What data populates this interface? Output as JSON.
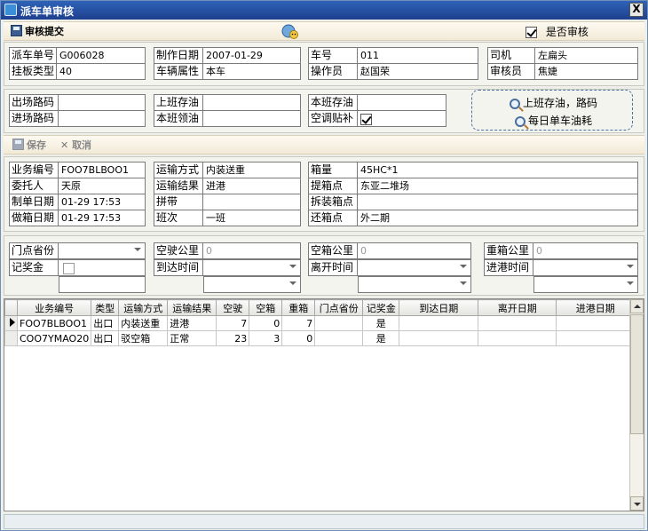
{
  "window": {
    "title": "派车单审核",
    "close_label": "X"
  },
  "toolbar1": {
    "audit_label": "审核提交",
    "is_audited_label": "是否审核",
    "is_audited": true
  },
  "header": [
    {
      "label": "派车单号",
      "value": "G006028"
    },
    {
      "label": "挂板类型",
      "value": "40"
    },
    {
      "label": "制作日期",
      "value": "2007-01-29"
    },
    {
      "label": "车辆属性",
      "value": "本车"
    },
    {
      "label": "车号",
      "value": "011"
    },
    {
      "label": "操作员",
      "value": "赵国荣"
    },
    {
      "label": "司机",
      "value": "左扁头"
    },
    {
      "label": "审核员",
      "value": "焦婕"
    }
  ],
  "fuel": {
    "exit_road_label": "出场路码",
    "exit_road_value": "",
    "enter_road_label": "进场路码",
    "enter_road_value": "",
    "prev_fuel_label": "上班存油",
    "prev_fuel_value": "",
    "shift_fuel_label": "本班领油",
    "shift_fuel_value": "",
    "curr_fuel_label": "本班存油",
    "curr_fuel_value": "",
    "ac_subsidy_label": "空调贴补",
    "ac_subsidy": true,
    "btn_prev_fuel": "上班存油，路码",
    "btn_daily_fuel": "每日单车油耗"
  },
  "toolbar2": {
    "save_label": "保存",
    "cancel_label": "取消"
  },
  "detail": [
    {
      "label": "业务编号",
      "value": "FOO7BLBOO1"
    },
    {
      "label": "委托人",
      "value": "天原"
    },
    {
      "label": "制单日期",
      "value": "01-29 17:53"
    },
    {
      "label": "做箱日期",
      "value": "01-29 17:53"
    },
    {
      "label": "运输方式",
      "value": "内装送重"
    },
    {
      "label": "运输结果",
      "value": "进港"
    },
    {
      "label": "拼带",
      "value": ""
    },
    {
      "label": "班次",
      "value": "一班"
    },
    {
      "label": "箱量",
      "value": "45HC*1"
    },
    {
      "label": "提箱点",
      "value": "东亚二堆场"
    },
    {
      "label": "拆装箱点",
      "value": ""
    },
    {
      "label": "还箱点",
      "value": "外二期"
    }
  ],
  "extra": {
    "door_province_label": "门点省份",
    "door_province_value": "",
    "reward_label": "记奖金",
    "empty_km_label": "空驶公里",
    "empty_km_value": "0",
    "arrive_time_label": "到达时间",
    "arrive_time_value": "",
    "empty_box_km_label": "空箱公里",
    "empty_box_km_value": "0",
    "leave_time_label": "离开时间",
    "leave_time_value": "",
    "heavy_box_km_label": "重箱公里",
    "heavy_box_km_value": "0",
    "enter_port_time_label": "进港时间",
    "enter_port_time_value": ""
  },
  "grid": {
    "columns": [
      "业务编号",
      "类型",
      "运输方式",
      "运输结果",
      "空驶",
      "空箱",
      "重箱",
      "门点省份",
      "记奖金",
      "到达日期",
      "离开日期",
      "进港日期"
    ],
    "rows": [
      [
        "FOO7BLBOO1",
        "出口",
        "内装送重",
        "进港",
        "7",
        "0",
        "7",
        "",
        "是",
        "",
        "",
        ""
      ],
      [
        "COO7YMAO20",
        "出口",
        "驳空箱",
        "正常",
        "23",
        "3",
        "0",
        "",
        "是",
        "",
        "",
        ""
      ]
    ]
  },
  "colors": {
    "title_bar": "#2a56a8",
    "toolbar": "#f6f0e0",
    "border": "#7a7a7a"
  },
  "icons": [
    "app-icon",
    "disk-icon",
    "globe-user-icon",
    "magnifier-icon",
    "cross-icon"
  ]
}
